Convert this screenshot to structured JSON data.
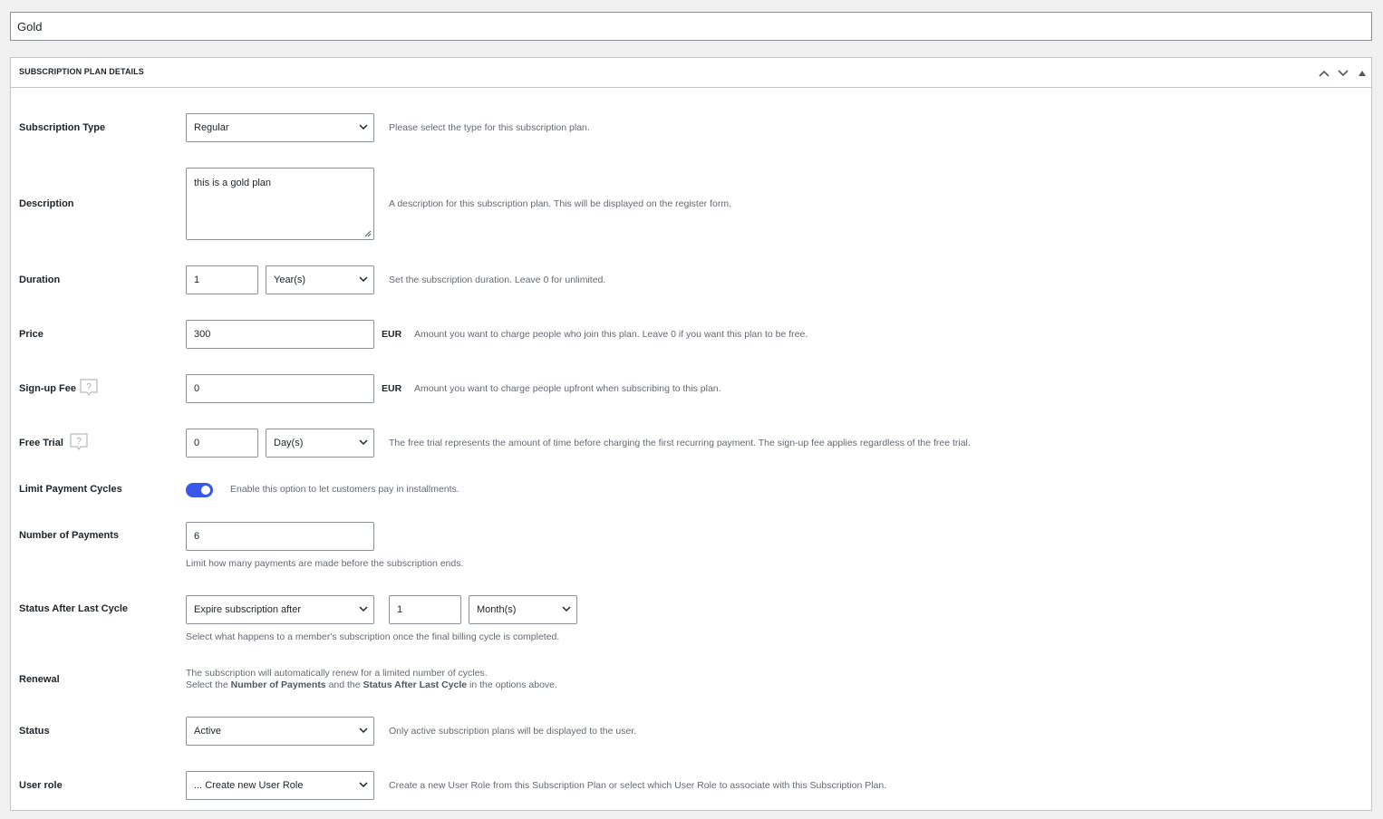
{
  "title_input": {
    "value": "Gold"
  },
  "metabox": {
    "title": "SUBSCRIPTION PLAN DETAILS",
    "icons": [
      "chevron-up-icon",
      "chevron-down-icon",
      "triangle-up-icon"
    ]
  },
  "fields": {
    "subscription_type": {
      "label": "Subscription Type",
      "value": "Regular",
      "desc": "Please select the type for this subscription plan."
    },
    "description": {
      "label": "Description",
      "value": "this is a gold plan",
      "desc": "A description for this subscription plan. This will be displayed on the register form."
    },
    "duration": {
      "label": "Duration",
      "value": "1",
      "unit": "Year(s)",
      "desc": "Set the subscription duration. Leave 0 for unlimited."
    },
    "price": {
      "label": "Price",
      "value": "300",
      "currency": "EUR",
      "desc": "Amount you want to charge people who join this plan. Leave 0 if you want this plan to be free."
    },
    "signup_fee": {
      "label": "Sign-up Fee",
      "value": "0",
      "currency": "EUR",
      "desc": "Amount you want to charge people upfront when subscribing to this plan."
    },
    "free_trial": {
      "label": "Free Trial",
      "value": "0",
      "unit": "Day(s)",
      "desc": "The free trial represents the amount of time before charging the first recurring payment. The sign-up fee applies regardless of the free trial."
    },
    "limit_payment_cycles": {
      "label": "Limit Payment Cycles",
      "enabled": true,
      "desc": "Enable this option to let customers pay in installments."
    },
    "number_of_payments": {
      "label": "Number of Payments",
      "value": "6",
      "desc": "Limit how many payments are made before the subscription ends."
    },
    "status_after_last_cycle": {
      "label": "Status After Last Cycle",
      "action": "Expire subscription after",
      "value": "1",
      "unit": "Month(s)",
      "desc": "Select what happens to a member's subscription once the final billing cycle is completed."
    },
    "renewal": {
      "label": "Renewal",
      "line1": "The subscription will automatically renew for a limited number of cycles.",
      "line2_pre": "Select the ",
      "line2_b1": "Number of Payments",
      "line2_mid": " and the ",
      "line2_b2": "Status After Last Cycle",
      "line2_post": " in the options above."
    },
    "status": {
      "label": "Status",
      "value": "Active",
      "desc": "Only active subscription plans will be displayed to the user."
    },
    "user_role": {
      "label": "User role",
      "value": "... Create new User Role",
      "desc": "Create a new User Role from this Subscription Plan or select which User Role to associate with this Subscription Plan."
    }
  },
  "colors": {
    "accent": "#3858e9",
    "border": "#c3c4c7",
    "muted_text": "#646970"
  }
}
